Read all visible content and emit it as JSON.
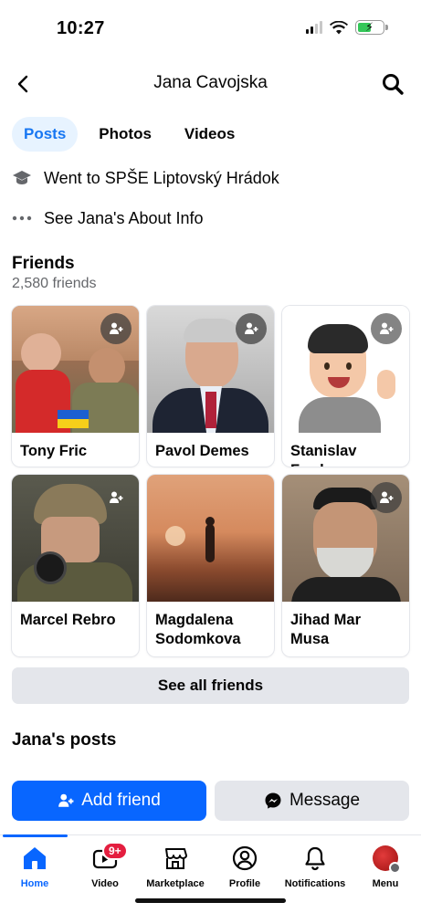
{
  "status_bar": {
    "time": "10:27"
  },
  "header": {
    "title": "Jana Cavojska"
  },
  "tabs": [
    {
      "label": "Posts",
      "active": true
    },
    {
      "label": "Photos",
      "active": false
    },
    {
      "label": "Videos",
      "active": false
    }
  ],
  "info": {
    "education": "Went to SPŠE Liptovský Hrádok",
    "about": "See Jana's About Info"
  },
  "friends": {
    "title": "Friends",
    "count": "2,580 friends",
    "items": [
      {
        "name": "Tony Fric"
      },
      {
        "name": "Pavol Demes"
      },
      {
        "name": "Stanislav Furda"
      },
      {
        "name": "Marcel Rebro"
      },
      {
        "name": "Magdalena Sodomkova"
      },
      {
        "name": "Jihad Mar Musa"
      }
    ],
    "see_all": "See all friends"
  },
  "posts": {
    "title": "Jana's posts"
  },
  "actions": {
    "add_friend": "Add friend",
    "message": "Message"
  },
  "nav": {
    "items": [
      {
        "label": "Home",
        "icon": "home-icon",
        "active": true
      },
      {
        "label": "Video",
        "icon": "video-icon",
        "badge": "9+"
      },
      {
        "label": "Marketplace",
        "icon": "marketplace-icon"
      },
      {
        "label": "Profile",
        "icon": "profile-icon"
      },
      {
        "label": "Notifications",
        "icon": "bell-icon"
      },
      {
        "label": "Menu",
        "icon": "menu-avatar-icon"
      }
    ]
  },
  "colors": {
    "accent": "#0866ff",
    "tab_active_bg": "#e7f3ff",
    "badge": "#e41e3f"
  }
}
